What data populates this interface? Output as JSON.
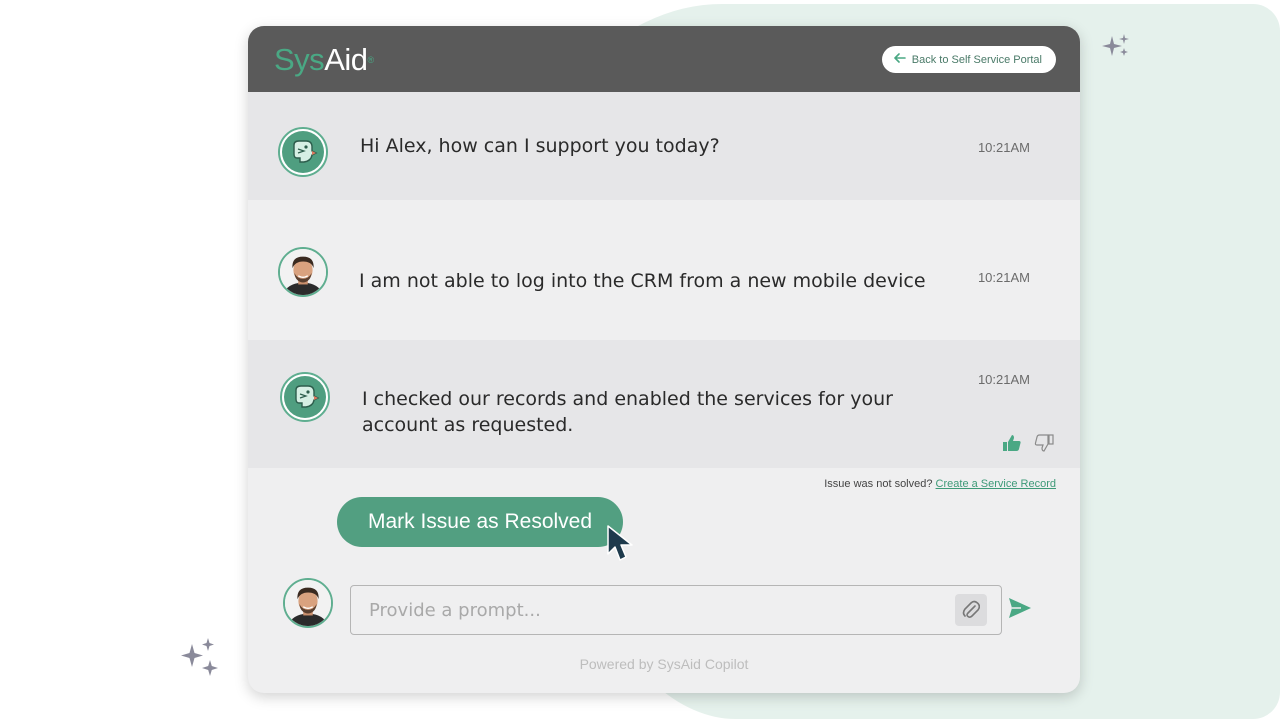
{
  "brand": {
    "logo_sys": "Sys",
    "logo_aid": "Aid",
    "logo_reg": "®"
  },
  "header": {
    "back_button_label": "Back to Self Service Portal"
  },
  "messages": [
    {
      "sender": "bot",
      "text": "Hi Alex, how can I support you today?",
      "time": "10:21AM"
    },
    {
      "sender": "user",
      "text": "I am not able to log into the CRM from a new mobile device",
      "time": "10:21AM"
    },
    {
      "sender": "bot",
      "text_line1": "I checked our records and enabled the services for your",
      "text_line2": "account as requested.",
      "time": "10:21AM"
    }
  ],
  "resolution": {
    "not_solved_text": "Issue was not solved?",
    "create_record_link": "Create a Service Record",
    "resolve_button_label": "Mark Issue as Resolved"
  },
  "composer": {
    "placeholder": "Provide a prompt..."
  },
  "footer": {
    "powered_by": "Powered by SysAid Copilot"
  },
  "icons": {
    "back": "arrow-left-icon",
    "attach": "paperclip-icon",
    "send": "send-icon",
    "like": "thumbs-up-icon",
    "dislike": "thumbs-down-icon",
    "cursor": "mouse-pointer-icon",
    "sparkle": "sparkle-icon",
    "bot_avatar": "bird-bot-icon"
  },
  "colors": {
    "accent": "#529f81",
    "header": "#5a5a5a",
    "background_blob": "#e5f1ec"
  }
}
